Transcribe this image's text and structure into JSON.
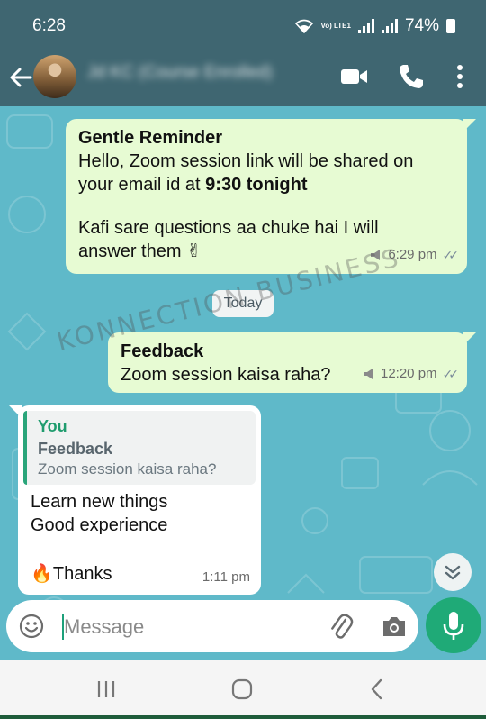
{
  "status_bar": {
    "time": "6:28",
    "battery": "74%",
    "network_label": "Vo) LTE1"
  },
  "header": {
    "contact_name": "Jd KC (Course Enrolled)"
  },
  "date_separator": "Today",
  "messages": [
    {
      "direction": "outgoing",
      "title": "Gentle Reminder",
      "line1": "Hello, Zoom session link will be shared on",
      "line2_prefix": "your email id at ",
      "line2_bold": "9:30 tonight",
      "line3": "Kafi sare questions aa chuke hai I will",
      "line4": "answer them",
      "emoji": "✌",
      "time": "6:29 pm"
    },
    {
      "direction": "outgoing",
      "title": "Feedback",
      "text": "Zoom session kaisa raha?",
      "time": "12:20 pm"
    },
    {
      "direction": "incoming",
      "quote_author": "You",
      "quote_title": "Feedback",
      "quote_text": "Zoom session kaisa raha?",
      "line1": "Learn  new things",
      "line2": "Good experience",
      "emoji": "🔥",
      "line3": "Thanks",
      "time": "1:11 pm"
    }
  ],
  "input": {
    "placeholder": "Message"
  },
  "watermark": "KONNECTION BUSINESS",
  "colors": {
    "header": "#3f6671",
    "outgoing": "#e7fbd3",
    "accent": "#1faa77",
    "wallpaper": "#5fb9c9"
  }
}
